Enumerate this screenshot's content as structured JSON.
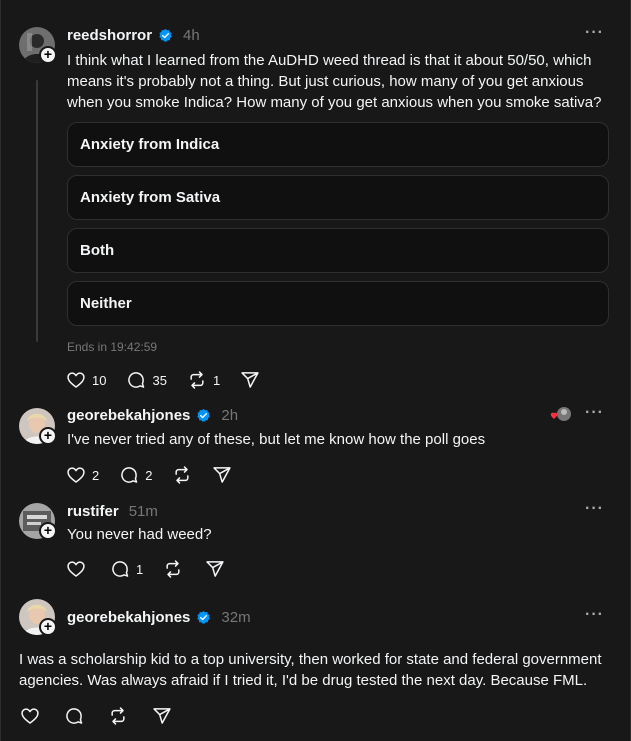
{
  "posts": [
    {
      "username": "reedshorror",
      "time": "4h",
      "text": "I think what I learned from the AuDHD weed thread is that it about 50/50, which means it's probably not a thing. But just curious, how many of you get anxious when you smoke Indica? How many of you get anxious when you smoke sativa?",
      "poll": {
        "options": [
          "Anxiety from Indica",
          "Anxiety from Sativa",
          "Both",
          "Neither"
        ],
        "ends": "Ends in 19:42:59"
      },
      "likes": "10",
      "replies": "35",
      "reposts": "1"
    },
    {
      "username": "georebekahjones",
      "time": "2h",
      "text": "I've never tried any of these, but let me know how the poll goes",
      "likes": "2",
      "replies": "2"
    },
    {
      "username": "rustifer",
      "time": "51m",
      "text": "You never had weed?",
      "replies": "1"
    },
    {
      "username": "georebekahjones",
      "time": "32m",
      "text": "I was a scholarship kid to a top university, then worked for state and federal government agencies. Was always afraid if I tried it, I'd be drug tested the next day. Because FML."
    }
  ],
  "icons": {
    "like": "heart-icon",
    "reply": "comment-icon",
    "repost": "repost-icon",
    "share": "send-icon",
    "more": "more-dots-icon",
    "verified": "verified-badge-icon"
  },
  "colors": {
    "background": "#181818",
    "verified": "#0095f6",
    "like_reaction": "#ff3040"
  }
}
